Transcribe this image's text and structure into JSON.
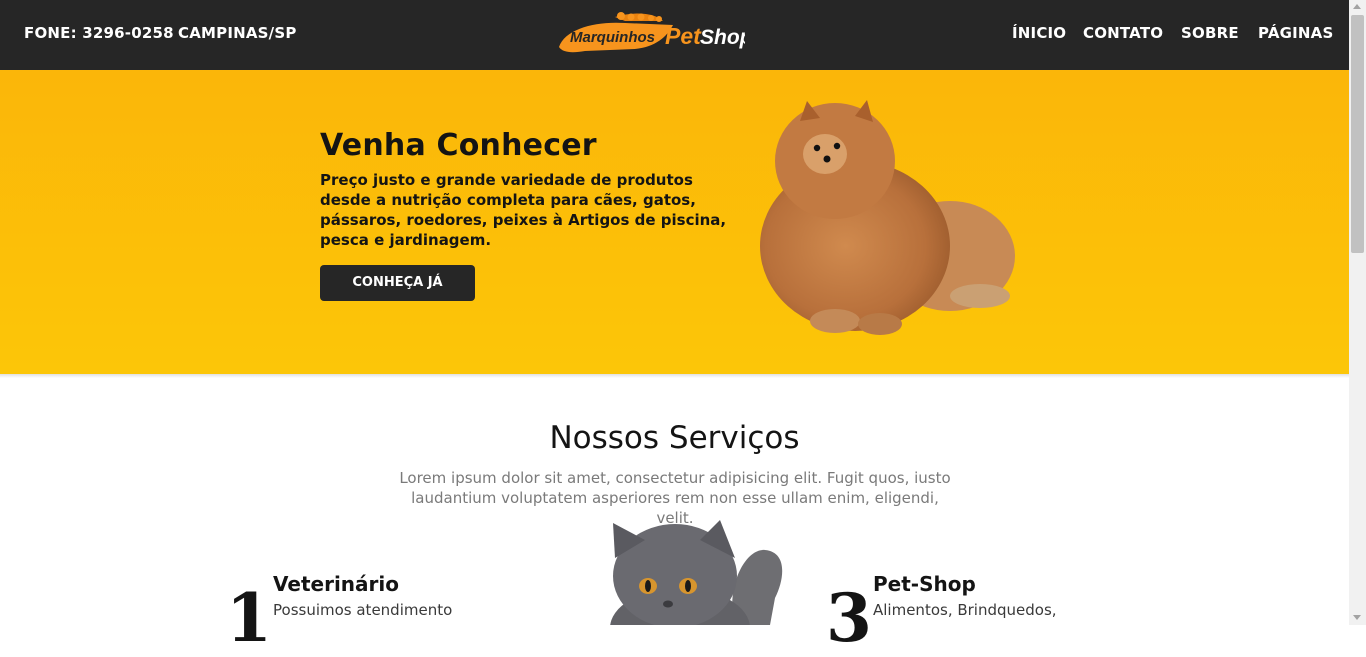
{
  "header": {
    "phone": "FONE: 3296-0258",
    "city": "CAMPINAS/SP",
    "logo_text_1": "Marquinhos",
    "logo_text_2": "Pet",
    "logo_text_3": "Shop",
    "menu": [
      {
        "label": "ÍNICIO"
      },
      {
        "label": "CONTATO"
      },
      {
        "label": "SOBRE"
      },
      {
        "label": "PÁGINAS"
      }
    ]
  },
  "hero": {
    "title": "Venha Conhecer",
    "description": "Preço justo e grande variedade de produtos desde a nutrição completa para cães, gatos, pássaros, roedores, peixes à Artigos de piscina, pesca e jardinagem.",
    "button_label": "CONHEÇA JÁ",
    "image": "pomeranian-dog-image"
  },
  "services": {
    "title": "Nossos Serviços",
    "description": "Lorem ipsum dolor sit amet, consectetur adipisicing elit. Fugit quos, iusto laudantium voluptatem asperiores rem non esse ullam enim, eligendi, velit.",
    "image": "gray-cat-image",
    "items": [
      {
        "number": "1",
        "title": "Veterinário",
        "line1": "Possuimos atendimento"
      },
      {
        "number": "3",
        "title": "Pet-Shop",
        "line1": "Alimentos, Brindquedos,"
      }
    ]
  },
  "colors": {
    "header_bg": "#262626",
    "hero_bg": "#fcc208",
    "logo_orange": "#f7941d",
    "button_bg": "#262626"
  }
}
